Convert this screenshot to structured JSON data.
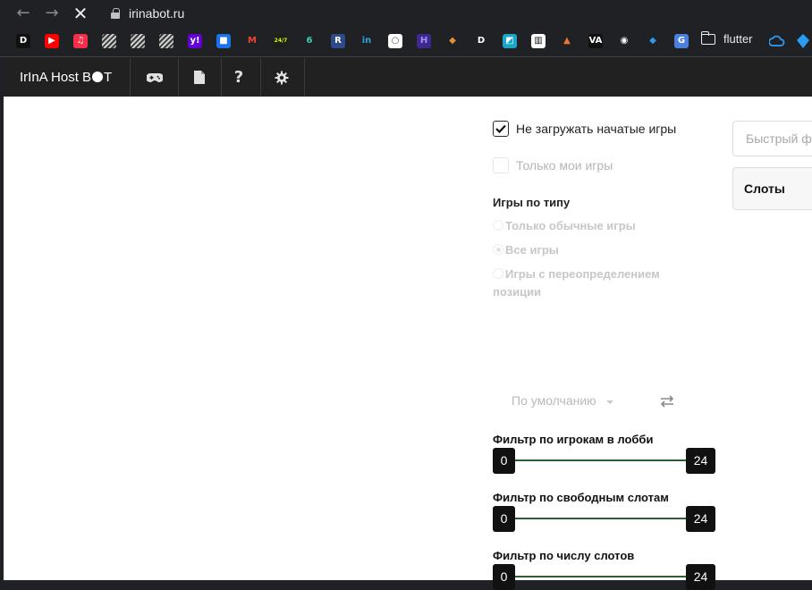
{
  "browser": {
    "url": "irinabot.ru",
    "bookmarks": [
      {
        "icon": "d-icon",
        "glyph": "D",
        "bg": "#111111",
        "fg": "#ffffff"
      },
      {
        "icon": "youtube-icon",
        "glyph": "▶",
        "bg": "#ff0000",
        "fg": "#ffffff"
      },
      {
        "icon": "music-icon",
        "glyph": "♫",
        "bg": "#fa2d48",
        "fg": "#ffffff"
      },
      {
        "icon": "striped-icon",
        "glyph": "",
        "bg": "#8a8a8a",
        "fg": "#ffffff"
      },
      {
        "icon": "striped-icon",
        "glyph": "",
        "bg": "#8a8a8a",
        "fg": "#ffffff"
      },
      {
        "icon": "striped-icon",
        "glyph": "",
        "bg": "#8a8a8a",
        "fg": "#ffffff"
      },
      {
        "icon": "yahoo-icon",
        "glyph": "y!",
        "bg": "#6001d2",
        "fg": "#ffffff"
      },
      {
        "icon": "chat-icon",
        "glyph": "■",
        "bg": "#1a73e8",
        "fg": "#ffffff"
      },
      {
        "icon": "gmail-icon",
        "glyph": "M",
        "bg": "#202124",
        "fg": "#ea4335"
      },
      {
        "icon": "calendar-247-icon",
        "glyph": "24/7",
        "bg": "#1e1e1e",
        "fg": "#c6ff00"
      },
      {
        "icon": "spiral-icon",
        "glyph": "6",
        "bg": "#202124",
        "fg": "#3ad0b0"
      },
      {
        "icon": "r-icon",
        "glyph": "R",
        "bg": "#2f4a8a",
        "fg": "#ffffff"
      },
      {
        "icon": "in-icon",
        "glyph": "in",
        "bg": "#202124",
        "fg": "#2aa3e0"
      },
      {
        "icon": "circle-logo-icon",
        "glyph": "○",
        "bg": "#ffffff",
        "fg": "#555555"
      },
      {
        "icon": "h-icon",
        "glyph": "H",
        "bg": "#3d2a8c",
        "fg": "#a78bff"
      },
      {
        "icon": "fox-icon",
        "glyph": "◆",
        "bg": "#202124",
        "fg": "#e8912d"
      },
      {
        "icon": "d-icon",
        "glyph": "D",
        "bg": "#202124",
        "fg": "#ffffff"
      },
      {
        "icon": "square-icon",
        "glyph": "◩",
        "bg": "#1aa6c8",
        "fg": "#ffffff"
      },
      {
        "icon": "trello-icon",
        "glyph": "▥",
        "bg": "#ffffff",
        "fg": "#111111"
      },
      {
        "icon": "tent-icon",
        "glyph": "▲",
        "bg": "#202124",
        "fg": "#e8782d"
      },
      {
        "icon": "va-icon",
        "glyph": "VA",
        "bg": "#111111",
        "fg": "#ffffff"
      },
      {
        "icon": "globe-icon",
        "glyph": "◉",
        "bg": "#202124",
        "fg": "#ffffff"
      },
      {
        "icon": "dart-icon",
        "glyph": "◆",
        "bg": "#202124",
        "fg": "#2b9bf4"
      },
      {
        "icon": "translate-icon",
        "glyph": "G",
        "bg": "#4a7fdd",
        "fg": "#ffffff"
      }
    ],
    "folder_label": "flutter",
    "extra_icons": [
      "cloud-icon",
      "dart-icon"
    ]
  },
  "app": {
    "brand_prefix": "IrInA Host B",
    "brand_suffix": "T",
    "nav_icons": [
      "gamepad-icon",
      "document-icon",
      "help-icon",
      "settings-icon"
    ],
    "nav_help_glyph": "?",
    "filters": {
      "hide_started_label": "Не загружать начатые игры",
      "hide_started_checked": true,
      "only_mine_label": "Только мои игры",
      "only_mine_checked": false,
      "game_type_title": "Игры по типу",
      "game_types": [
        {
          "label": "Только обычные игры",
          "selected": false
        },
        {
          "label": "Все игры",
          "selected": true
        },
        {
          "label": "Игры с переопределением позиции",
          "selected": false
        }
      ],
      "sort_value": "По умолчанию",
      "sliders": [
        {
          "title": "Фильтр по игрокам в лобби",
          "min": "0",
          "max": "24"
        },
        {
          "title": "Фильтр по свободным слотам",
          "min": "0",
          "max": "24"
        },
        {
          "title": "Фильтр по числу слотов",
          "min": "0",
          "max": "24"
        }
      ]
    },
    "quick_filter_placeholder": "Быстрый ф",
    "slots_header": "Слоты"
  }
}
